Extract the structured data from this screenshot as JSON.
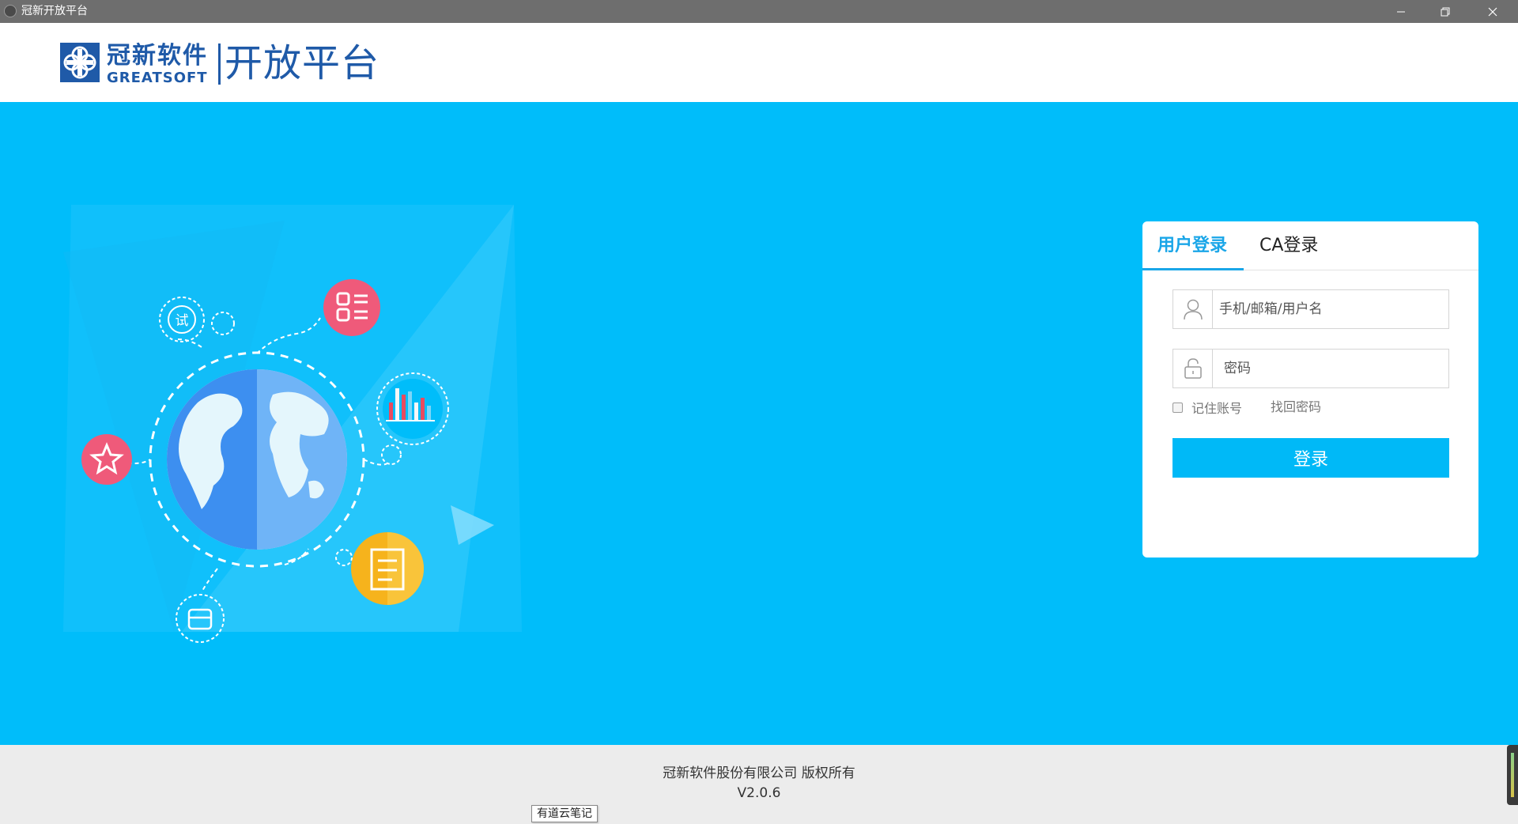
{
  "window": {
    "title": "冠新开放平台"
  },
  "header": {
    "brand_cn": "冠新软件",
    "brand_en": "GREATSOFT",
    "brand_platform": "开放平台"
  },
  "illustration": {
    "trial_badge": "试"
  },
  "login": {
    "tabs": [
      {
        "label": "用户登录",
        "active": true
      },
      {
        "label": "CA登录",
        "active": false
      }
    ],
    "username_placeholder": "手机/邮箱/用户名",
    "password_placeholder": "密码",
    "remember_label": "记住账号",
    "remember_checked": false,
    "forgot_label": "找回密码",
    "submit_label": "登录"
  },
  "footer": {
    "copyright": "冠新软件股份有限公司 版权所有",
    "version": "V2.0.6",
    "tooltip": "有道云笔记"
  },
  "colors": {
    "banner": "#00bdfa",
    "brand": "#1f5aa8",
    "accent": "#1aa6e8",
    "button": "#00b9f7"
  }
}
